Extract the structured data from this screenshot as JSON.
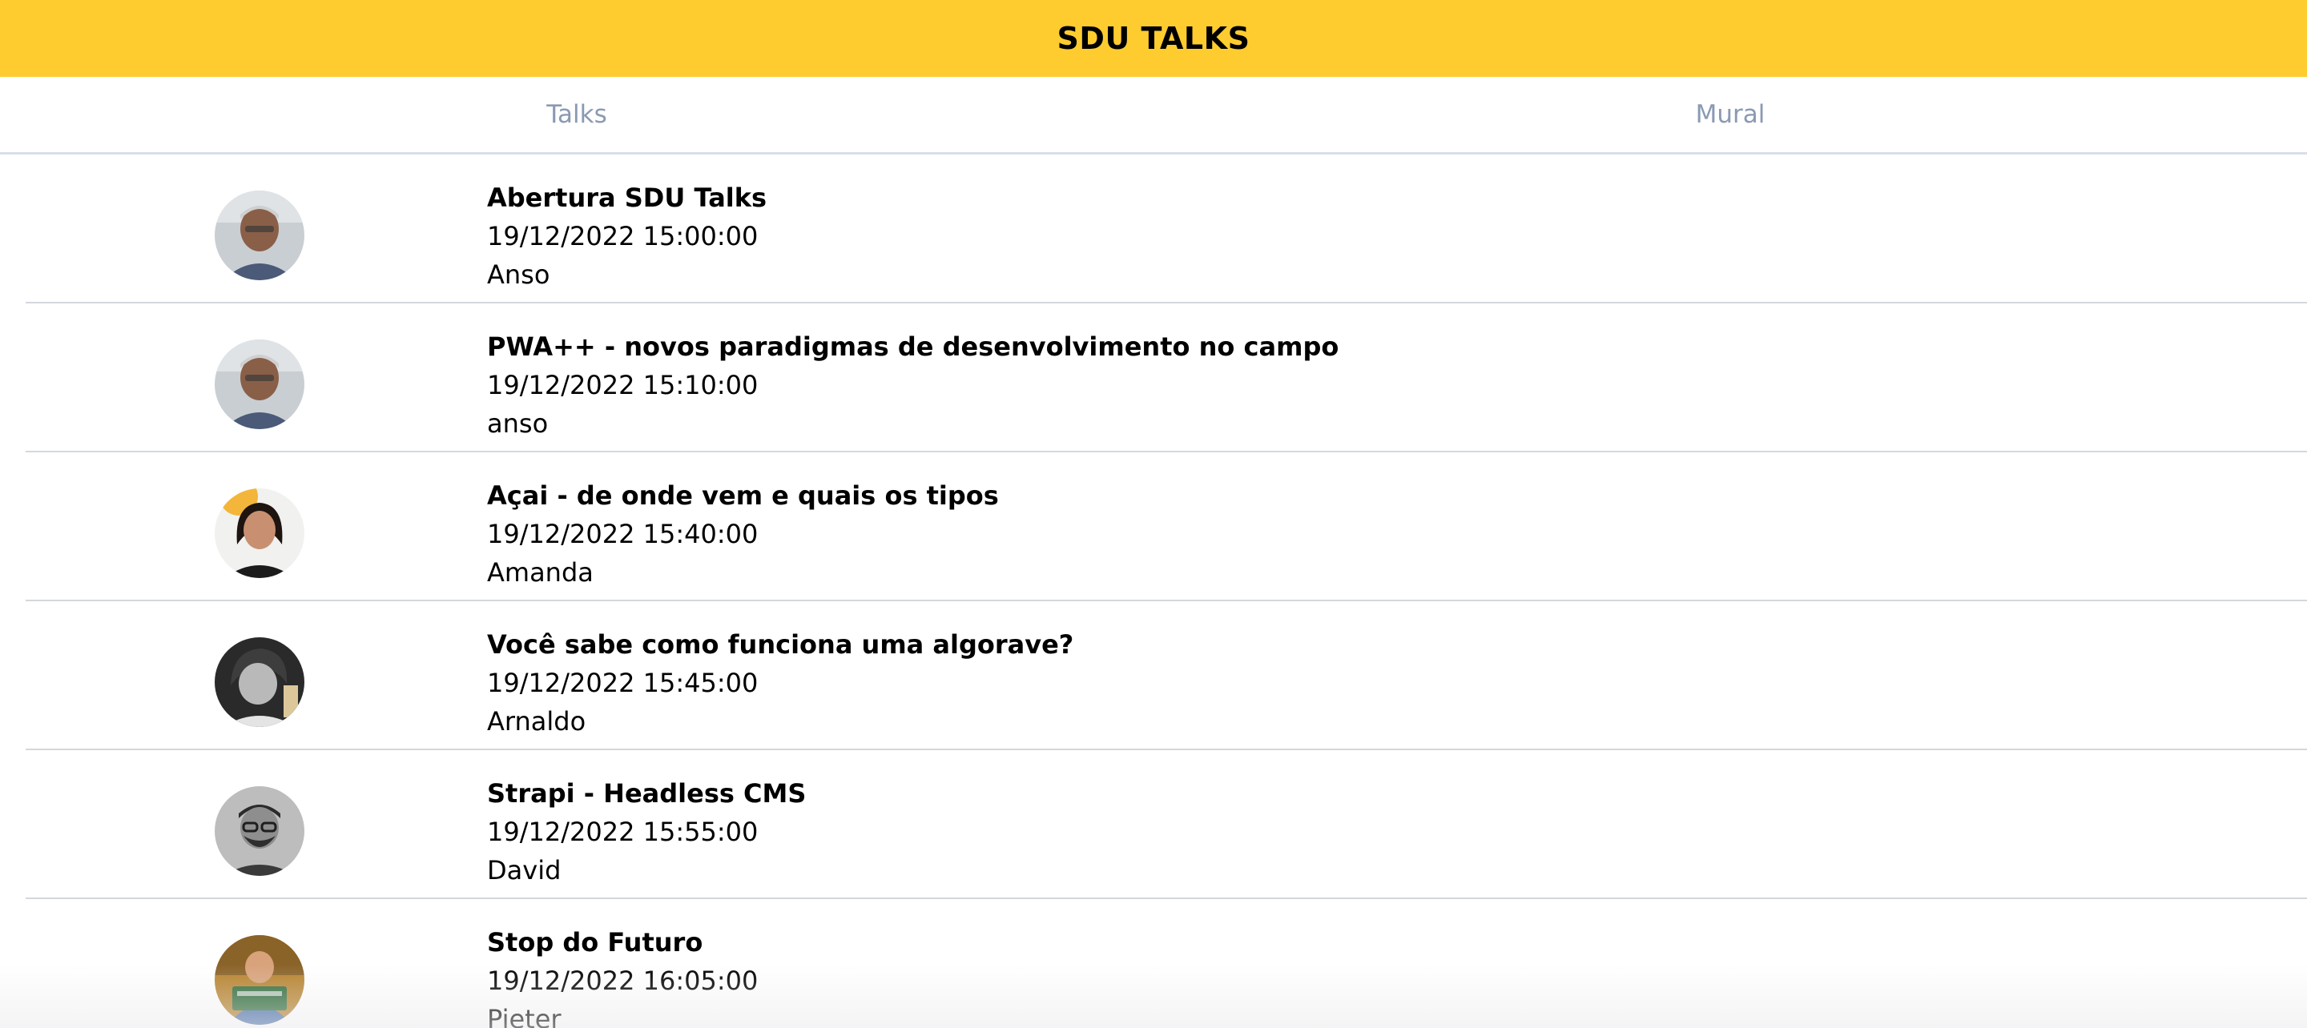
{
  "header": {
    "title": "SDU TALKS"
  },
  "tabs": [
    {
      "label": "Talks"
    },
    {
      "label": "Mural"
    }
  ],
  "colors": {
    "header_bg": "#FECC2F",
    "tab_text": "#8A9AB2",
    "divider": "#D4D7DC"
  },
  "talks": [
    {
      "title": "Abertura SDU Talks",
      "datetime": "19/12/2022 15:00:00",
      "speaker": "Anso",
      "avatar": "speaker-photo"
    },
    {
      "title": "PWA++ - novos paradigmas de desenvolvimento no campo",
      "datetime": "19/12/2022 15:10:00",
      "speaker": "anso",
      "avatar": "speaker-photo"
    },
    {
      "title": "Açai - de onde vem e quais os tipos",
      "datetime": "19/12/2022 15:40:00",
      "speaker": "Amanda",
      "avatar": "speaker-photo"
    },
    {
      "title": "Você sabe como funciona uma algorave?",
      "datetime": "19/12/2022 15:45:00",
      "speaker": "Arnaldo",
      "avatar": "speaker-photo"
    },
    {
      "title": "Strapi - Headless CMS",
      "datetime": "19/12/2022 15:55:00",
      "speaker": "David",
      "avatar": "speaker-photo"
    },
    {
      "title": "Stop do Futuro",
      "datetime": "19/12/2022 16:05:00",
      "speaker": "Pieter",
      "avatar": "speaker-photo"
    }
  ]
}
